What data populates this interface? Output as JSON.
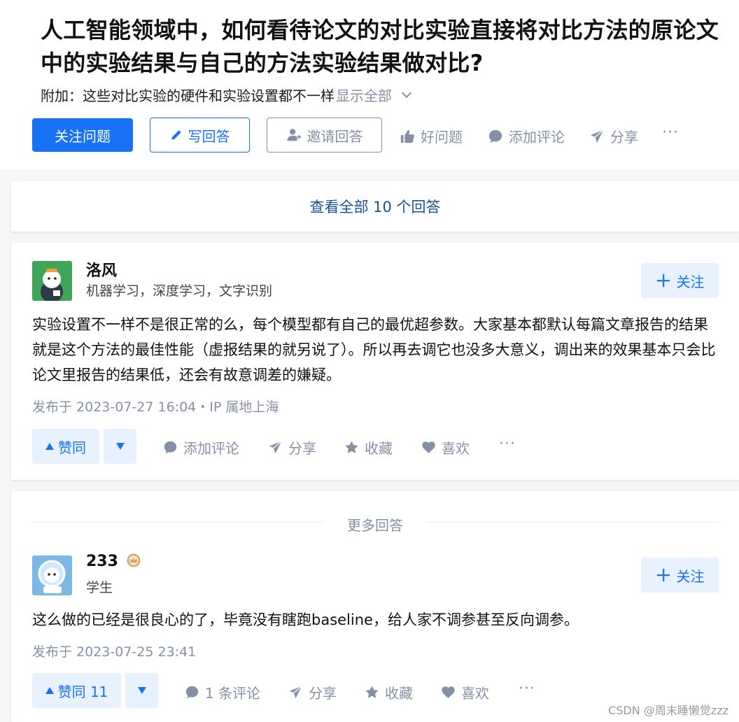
{
  "question": {
    "title": "人工智能领域中，如何看待论文的对比实验直接将对比方法的原论文中的实验结果与自己的方法实验结果做对比?",
    "detail": "附加：这些对比实验的硬件和实验设置都不一样",
    "show_all": "显示全部",
    "buttons": {
      "follow": "关注问题",
      "write": "写回答",
      "invite": "邀请回答",
      "good_question": "好问题",
      "add_comment": "添加评论",
      "share": "分享",
      "more": "···"
    }
  },
  "view_all": "查看全部 10 个回答",
  "answers": [
    {
      "author": "洛风",
      "bio": "机器学习，深度学习，文字识别",
      "follow": "关注",
      "content": "实验设置不一样不是很正常的么，每个模型都有自己的最优超参数。大家基本都默认每篇文章报告的结果就是这个方法的最佳性能（虚报结果的就另说了）。所以再去调它也没多大意义，调出来的效果基本只会比论文里报告的结果低，还会有故意调差的嫌疑。",
      "time": "发布于 2023-07-27 16:04・IP 属地上海",
      "vote": "赞同",
      "comment": "添加评论",
      "share": "分享",
      "collect": "收藏",
      "like": "喜欢",
      "more": "···"
    },
    {
      "author": "233",
      "bio": "学生",
      "follow": "关注",
      "content": "这么做的已经是很良心的了，毕竟没有瞎跑baseline，给人家不调参甚至反向调参。",
      "time": "发布于 2023-07-25 23:41",
      "vote": "赞同 11",
      "comment": "1 条评论",
      "share": "分享",
      "collect": "收藏",
      "like": "喜欢",
      "more": "···"
    }
  ],
  "more_answers": "更多回答",
  "watermark": "CSDN @周末睡懒觉zzz",
  "colors": {
    "primary": "#1772f6",
    "primary_light": "#e8f1fe",
    "muted": "#8590a6",
    "link": "#175199"
  }
}
